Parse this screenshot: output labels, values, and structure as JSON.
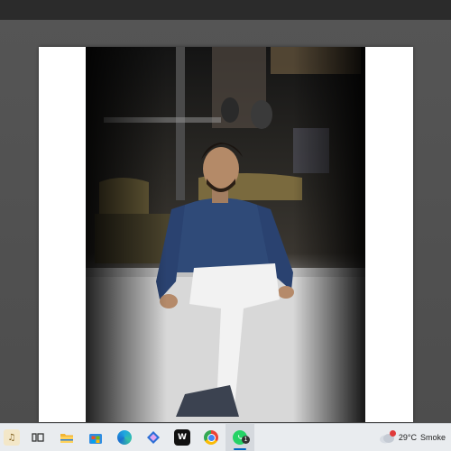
{
  "taskbar": {
    "apps": [
      {
        "icon": "pinned-app-icon"
      },
      {
        "icon": "task-view-icon"
      },
      {
        "icon": "file-explorer-icon"
      },
      {
        "icon": "microsoft-store-icon"
      },
      {
        "icon": "edge-browser-icon"
      },
      {
        "icon": "photos-app-icon"
      },
      {
        "icon": "capcut-icon"
      },
      {
        "icon": "chrome-icon"
      },
      {
        "icon": "whatsapp-icon"
      }
    ],
    "whatsapp_badge": "1",
    "weather": {
      "temperature": "29°C",
      "condition": "Smoke"
    }
  }
}
